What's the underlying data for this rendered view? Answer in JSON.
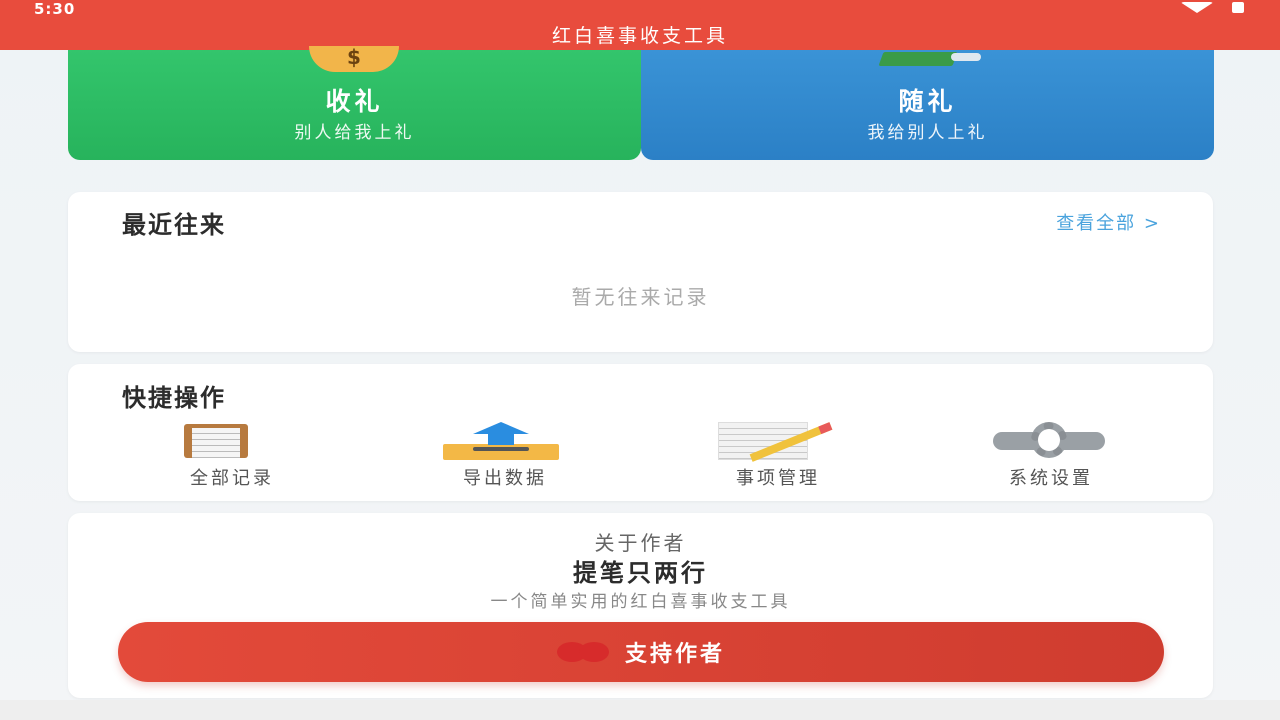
{
  "status_bar": {
    "time": "5:30"
  },
  "app": {
    "title": "红白喜事收支工具"
  },
  "gift_cards": {
    "receive": {
      "title": "收礼",
      "subtitle": "别人给我上礼",
      "icon_text": "$"
    },
    "give": {
      "title": "随礼",
      "subtitle": "我给别人上礼"
    }
  },
  "recent": {
    "heading": "最近往来",
    "view_all": "查看全部 >",
    "empty": "暂无往来记录"
  },
  "quick_actions": {
    "heading": "快捷操作",
    "items": [
      {
        "label": "全部记录",
        "icon": "clipboard-icon"
      },
      {
        "label": "导出数据",
        "icon": "export-icon"
      },
      {
        "label": "事项管理",
        "icon": "notepad-pencil-icon"
      },
      {
        "label": "系统设置",
        "icon": "gear-icon"
      }
    ]
  },
  "about": {
    "label": "关于作者",
    "name": "提笔只两行",
    "description": "一个简单实用的红白喜事收支工具",
    "support_button": "支持作者"
  },
  "colors": {
    "brand_red": "#e84c3d",
    "receive_green": "#2fbf66",
    "give_blue": "#348bcf",
    "link_blue": "#4aa3dd"
  }
}
